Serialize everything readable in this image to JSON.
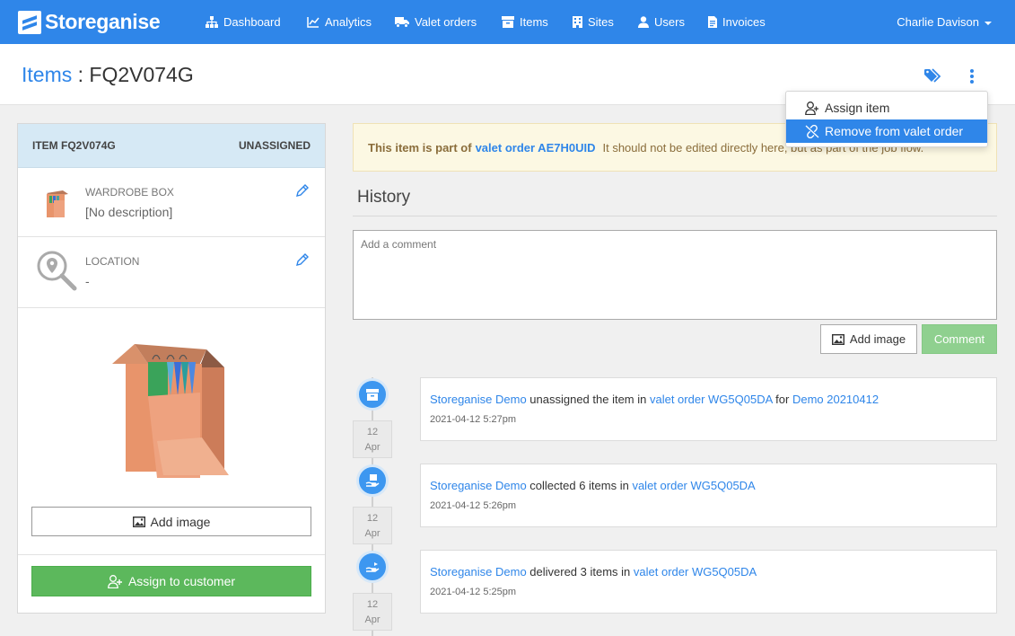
{
  "navbar": {
    "brand": "Storeganise",
    "items": [
      {
        "label": "Dashboard",
        "icon": "sitemap-icon"
      },
      {
        "label": "Analytics",
        "icon": "chart-icon"
      },
      {
        "label": "Valet orders",
        "icon": "truck-icon"
      },
      {
        "label": "Items",
        "icon": "archive-icon"
      },
      {
        "label": "Sites",
        "icon": "building-icon"
      },
      {
        "label": "Users",
        "icon": "user-icon"
      },
      {
        "label": "Invoices",
        "icon": "file-icon"
      }
    ],
    "user": "Charlie Davison"
  },
  "header": {
    "crumb": "Items",
    "separator": " : ",
    "item_id": "FQ2V074G"
  },
  "dropdown": {
    "items": [
      {
        "label": "Assign item",
        "icon": "user-plus-icon"
      },
      {
        "label": "Remove from valet order",
        "icon": "unlink-icon"
      }
    ],
    "active_index": 1
  },
  "item_panel": {
    "title": "ITEM FQ2V074G",
    "status": "UNASSIGNED",
    "type_label": "WARDROBE BOX",
    "description": "[No description]",
    "location_label": "LOCATION",
    "location_value": "-",
    "add_image_label": "Add image",
    "assign_label": "Assign to customer"
  },
  "alert": {
    "prefix": "This item is part of",
    "order_link": "valet order AE7H0UID",
    "suffix": "It should not be edited directly here, but as part of the job flow."
  },
  "history": {
    "title": "History",
    "comment_placeholder": "Add a comment",
    "add_image_label": "Add image",
    "comment_label": "Comment",
    "entries": [
      {
        "icon": "archive-icon",
        "day": "12",
        "month": "Apr",
        "actor": "Storeganise Demo",
        "action": " unassigned the item in ",
        "target": "valet order WG5Q05DA",
        "extra": " for ",
        "extra_link": "Demo 20210412",
        "timestamp": "2021-04-12 5:27pm"
      },
      {
        "icon": "hand-box-icon",
        "day": "12",
        "month": "Apr",
        "actor": "Storeganise Demo",
        "action": " collected 6 items in ",
        "target": "valet order WG5Q05DA",
        "extra": "",
        "extra_link": "",
        "timestamp": "2021-04-12 5:26pm"
      },
      {
        "icon": "hand-deliver-icon",
        "day": "12",
        "month": "Apr",
        "actor": "Storeganise Demo",
        "action": " delivered 3 items in ",
        "target": "valet order WG5Q05DA",
        "extra": "",
        "extra_link": "",
        "timestamp": "2021-04-12 5:25pm"
      }
    ]
  },
  "colors": {
    "primary": "#2f86e9",
    "success": "#5cb85c",
    "warning_bg": "#fcf8e3",
    "panel_header": "#d6e9f5"
  }
}
